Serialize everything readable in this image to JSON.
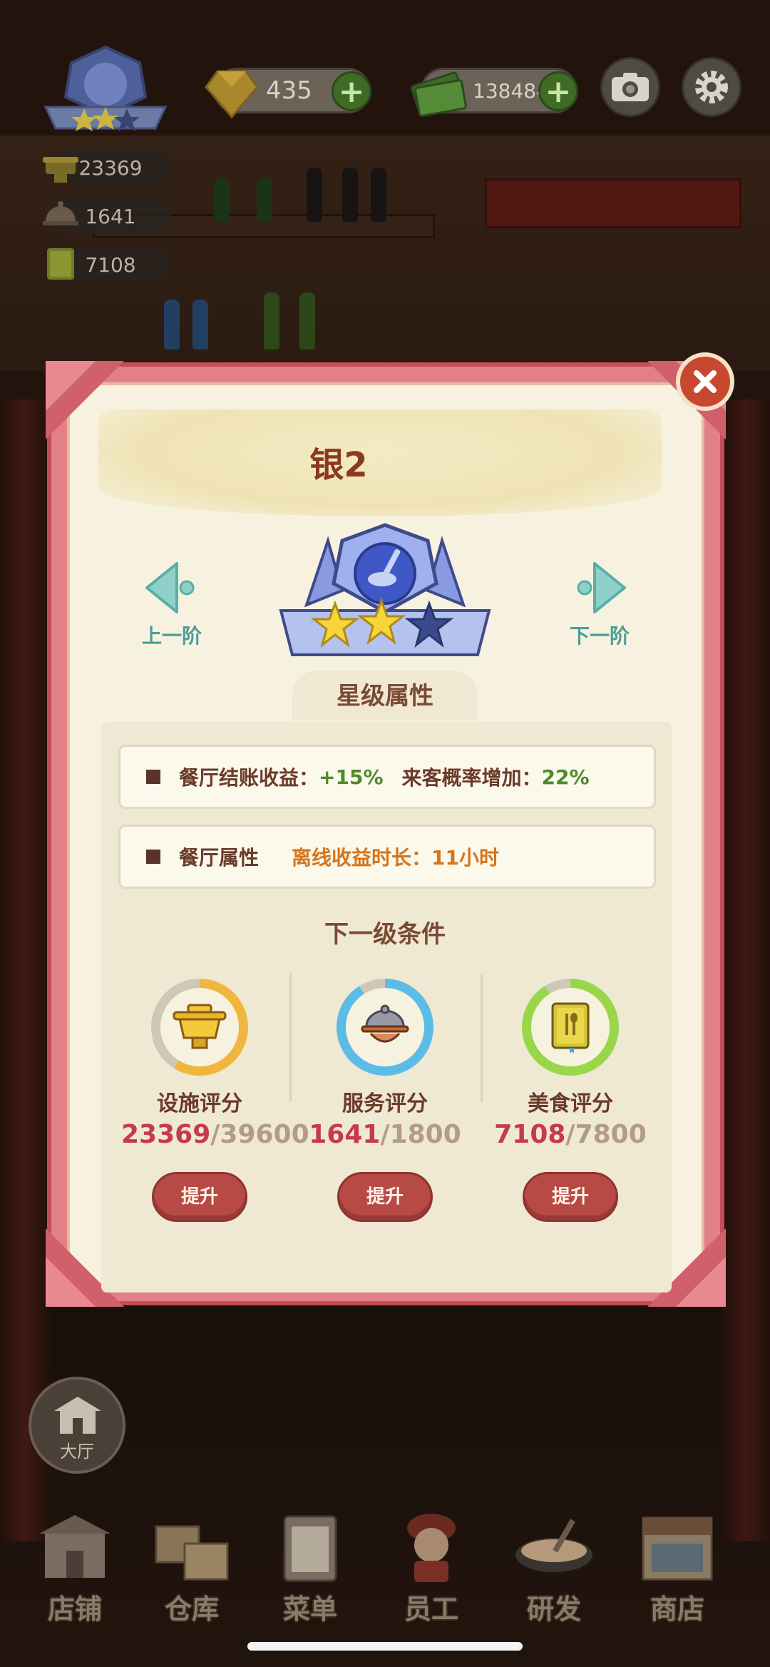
{
  "hud": {
    "gems": "435",
    "cash": "1384848",
    "facility_score": "23369",
    "service_score": "1641",
    "food_score": "7108"
  },
  "modal": {
    "title": "银2",
    "prev_tier_label": "上一阶",
    "next_tier_label": "下一阶",
    "current_stars": 2,
    "max_stars": 3,
    "section_title": "星级属性",
    "attributes": [
      {
        "label": "餐厅结账收益：",
        "value": "+15%",
        "label2": "来客概率增加：",
        "value2": "22%"
      },
      {
        "label": "餐厅属性",
        "label2": "离线收益时长：",
        "value2": "11小时"
      }
    ],
    "next_level_title": "下一级条件",
    "requirements": [
      {
        "name": "设施评分",
        "current": "23369",
        "target": "/39600",
        "progress": 0.59,
        "color": "#f0b640",
        "icon": "gold-cauldron-icon",
        "button": "提升"
      },
      {
        "name": "服务评分",
        "current": "1641",
        "target": "/1800",
        "progress": 0.91,
        "color": "#5bbde6",
        "icon": "serving-cloche-icon",
        "button": "提升"
      },
      {
        "name": "美食评分",
        "current": "7108",
        "target": "/7800",
        "progress": 0.91,
        "color": "#9ad64a",
        "icon": "recipe-book-icon",
        "button": "提升"
      }
    ]
  },
  "side": {
    "hall_label": "大厅"
  },
  "bottom_nav": [
    {
      "label": "店铺",
      "icon": "shop-building-icon"
    },
    {
      "label": "仓库",
      "icon": "warehouse-boxes-icon"
    },
    {
      "label": "菜单",
      "icon": "menu-clipboard-icon"
    },
    {
      "label": "员工",
      "icon": "staff-chef-icon"
    },
    {
      "label": "研发",
      "icon": "research-wok-icon"
    },
    {
      "label": "商店",
      "icon": "store-stall-icon"
    }
  ]
}
